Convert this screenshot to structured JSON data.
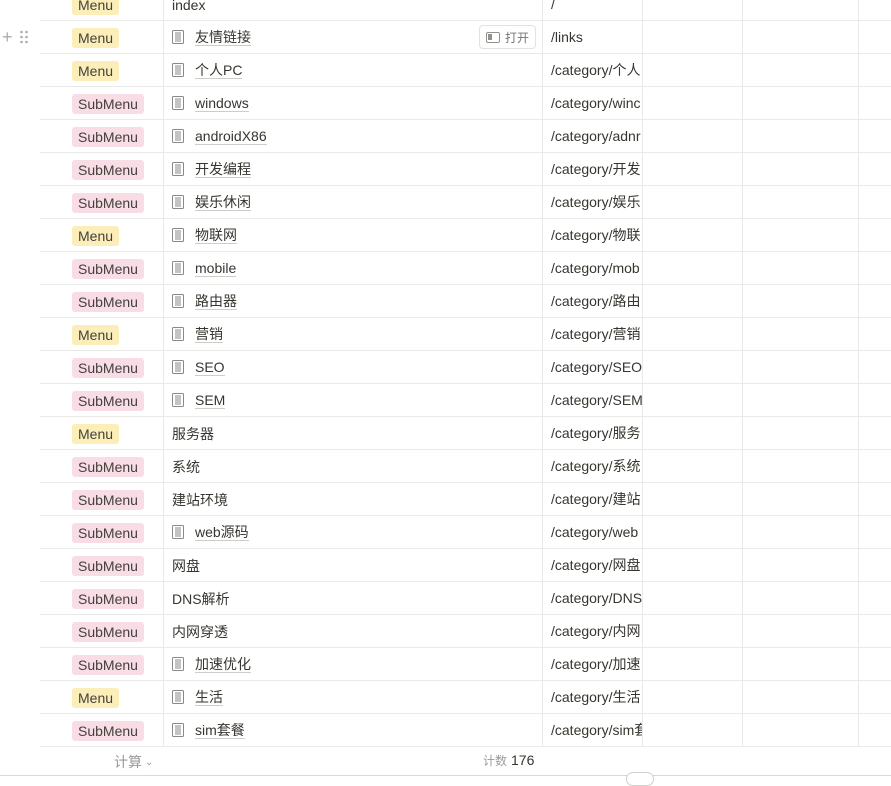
{
  "rows": [
    {
      "type": "Menu",
      "type_class": "menu",
      "name": "index",
      "has_icon": false,
      "path": "/"
    },
    {
      "type": "Menu",
      "type_class": "menu",
      "name": "友情链接",
      "has_icon": true,
      "path": "/links",
      "hovered": true
    },
    {
      "type": "Menu",
      "type_class": "menu",
      "name": "个人PC",
      "has_icon": true,
      "path": "/category/个人"
    },
    {
      "type": "SubMenu",
      "type_class": "submenu",
      "name": "windows",
      "has_icon": true,
      "path": "/category/winc"
    },
    {
      "type": "SubMenu",
      "type_class": "submenu",
      "name": "androidX86",
      "has_icon": true,
      "path": "/category/adnr"
    },
    {
      "type": "SubMenu",
      "type_class": "submenu",
      "name": "开发编程",
      "has_icon": true,
      "path": "/category/开发"
    },
    {
      "type": "SubMenu",
      "type_class": "submenu",
      "name": "娱乐休闲",
      "has_icon": true,
      "path": "/category/娱乐"
    },
    {
      "type": "Menu",
      "type_class": "menu",
      "name": "物联网",
      "has_icon": true,
      "path": "/category/物联"
    },
    {
      "type": "SubMenu",
      "type_class": "submenu",
      "name": "mobile",
      "has_icon": true,
      "path": "/category/mob"
    },
    {
      "type": "SubMenu",
      "type_class": "submenu",
      "name": "路由器",
      "has_icon": true,
      "path": "/category/路由"
    },
    {
      "type": "Menu",
      "type_class": "menu",
      "name": "营销",
      "has_icon": true,
      "path": "/category/营销"
    },
    {
      "type": "SubMenu",
      "type_class": "submenu",
      "name": "SEO",
      "has_icon": true,
      "path": "/category/SEO"
    },
    {
      "type": "SubMenu",
      "type_class": "submenu",
      "name": "SEM",
      "has_icon": true,
      "path": "/category/SEM"
    },
    {
      "type": "Menu",
      "type_class": "menu",
      "name": "服务器",
      "has_icon": false,
      "path": "/category/服务"
    },
    {
      "type": "SubMenu",
      "type_class": "submenu",
      "name": "系统",
      "has_icon": false,
      "path": "/category/系统"
    },
    {
      "type": "SubMenu",
      "type_class": "submenu",
      "name": "建站环境",
      "has_icon": false,
      "path": "/category/建站"
    },
    {
      "type": "SubMenu",
      "type_class": "submenu",
      "name": "web源码",
      "has_icon": true,
      "path": "/category/web"
    },
    {
      "type": "SubMenu",
      "type_class": "submenu",
      "name": "网盘",
      "has_icon": false,
      "path": "/category/网盘"
    },
    {
      "type": "SubMenu",
      "type_class": "submenu",
      "name": "DNS解析",
      "has_icon": false,
      "path": "/category/DNS"
    },
    {
      "type": "SubMenu",
      "type_class": "submenu",
      "name": "内网穿透",
      "has_icon": false,
      "path": "/category/内网"
    },
    {
      "type": "SubMenu",
      "type_class": "submenu",
      "name": "加速优化",
      "has_icon": true,
      "path": "/category/加速"
    },
    {
      "type": "Menu",
      "type_class": "menu",
      "name": "生活",
      "has_icon": true,
      "path": "/category/生活"
    },
    {
      "type": "SubMenu",
      "type_class": "submenu",
      "name": "sim套餐",
      "has_icon": true,
      "path": "/category/sim套"
    }
  ],
  "open_button_label": "打开",
  "footer": {
    "calc_label": "计算",
    "count_label": "计数",
    "count_value": "176"
  },
  "colors": {
    "menu_tag": "#fbeeb8",
    "submenu_tag": "#f9dde6"
  },
  "icons": {
    "page": "document-icon",
    "add": "plus-icon",
    "drag": "drag-handle-icon",
    "open": "side-peek-icon",
    "calc_dropdown": "chevron-down-icon"
  }
}
